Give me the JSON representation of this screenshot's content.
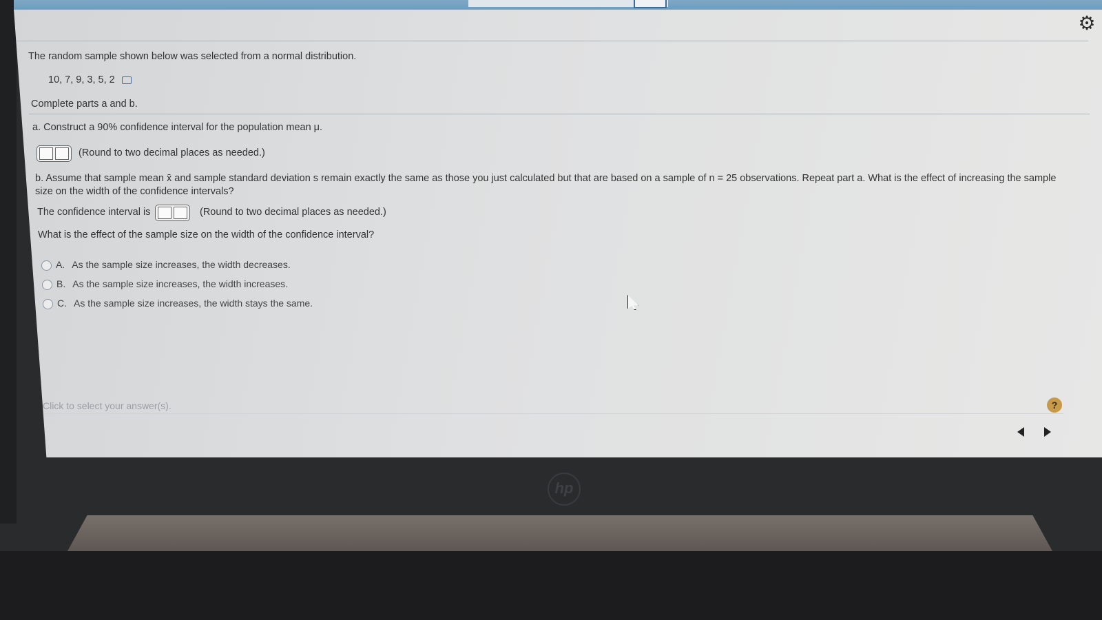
{
  "question": {
    "intro": "The random sample shown below was selected from a normal distribution.",
    "sample_values": "10, 7, 9, 3, 5, 2",
    "instructions": "Complete parts a and b.",
    "part_a": {
      "prompt": "a. Construct a 90% confidence interval for the population mean μ.",
      "round_note": "(Round to two decimal places as needed.)"
    },
    "part_b": {
      "prompt_line1": "b. Assume that sample mean x̄ and sample standard deviation s remain exactly the same as those you just calculated but that are based on a sample of n = 25 observations. Repeat part a. What is the effect of increasing the sample",
      "prompt_line2": "size on the width of the confidence intervals?",
      "interval_label": "The confidence interval is",
      "round_note": "(Round to two decimal places as needed.)",
      "effect_question": "What is the effect of the sample size on the width of the confidence interval?",
      "options": [
        {
          "letter": "A.",
          "text": "As the sample size increases, the width decreases."
        },
        {
          "letter": "B.",
          "text": "As the sample size increases, the width increases."
        },
        {
          "letter": "C.",
          "text": "As the sample size increases, the width stays the same."
        }
      ]
    }
  },
  "footer": {
    "click_note": "Click to select your answer(s).",
    "help_label": "?"
  },
  "icons": {
    "settings": "gear-icon",
    "data_copy": "copy-data-icon",
    "prev": "chevron-left-icon",
    "next": "chevron-right-icon"
  },
  "brand": {
    "logo": "hp"
  },
  "colors": {
    "help_badge": "#c79a4a",
    "screen_bg": "#e0e1e2"
  }
}
